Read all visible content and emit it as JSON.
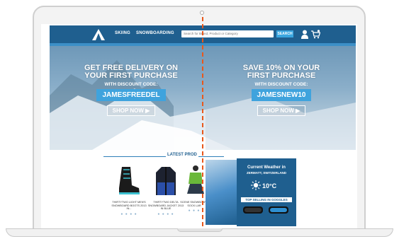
{
  "header": {
    "nav": [
      "SKIING",
      "SNOWBOARDING"
    ],
    "search_placeholder": "Search for Brand, Product or Category",
    "search_button": "SEARCH",
    "icons": [
      "mountain-logo-icon",
      "user-icon",
      "cart-icon"
    ]
  },
  "promos": [
    {
      "title_line1": "GET FREE DELIVERY ON",
      "title_line2": "YOUR FIRST PURCHASE",
      "subtitle": "WITH DISCOUNT CODE:",
      "code": "JAMESFREEDEL",
      "cta": "SHOP NOW ▶"
    },
    {
      "title_line1": "SAVE 10% ON YOUR",
      "title_line2": "FIRST PURCHASE",
      "subtitle": "WITH DISCOUNT CODE:",
      "code": "JAMESNEW10",
      "cta": "SHOP NOW ▶"
    }
  ],
  "latest": {
    "label": "LATEST PROD",
    "products": [
      {
        "name": "THIRTYTWO LIGHT MEN'S SNOWBOARD BOOTS 2013 IN...",
        "dots": "● ● ● ●"
      },
      {
        "name": "THIRTYTWO DELTA SNOWBOARD JACKET 2013 IN BLUE",
        "dots": "● ● ● ●"
      },
      {
        "name": "SCENE SNOWBOARD SOCK LAR",
        "dots": "● ● ●"
      }
    ]
  },
  "weather": {
    "title": "Current Weather in",
    "location": "ZERMATT, SWITZERLAND",
    "temp": "10°C",
    "goggles_label": "TOP SELLING IN GOGGLES"
  },
  "colors": {
    "brand": "#1f5f8f",
    "accent": "#3fa3dd",
    "divider": "#e8581c"
  }
}
